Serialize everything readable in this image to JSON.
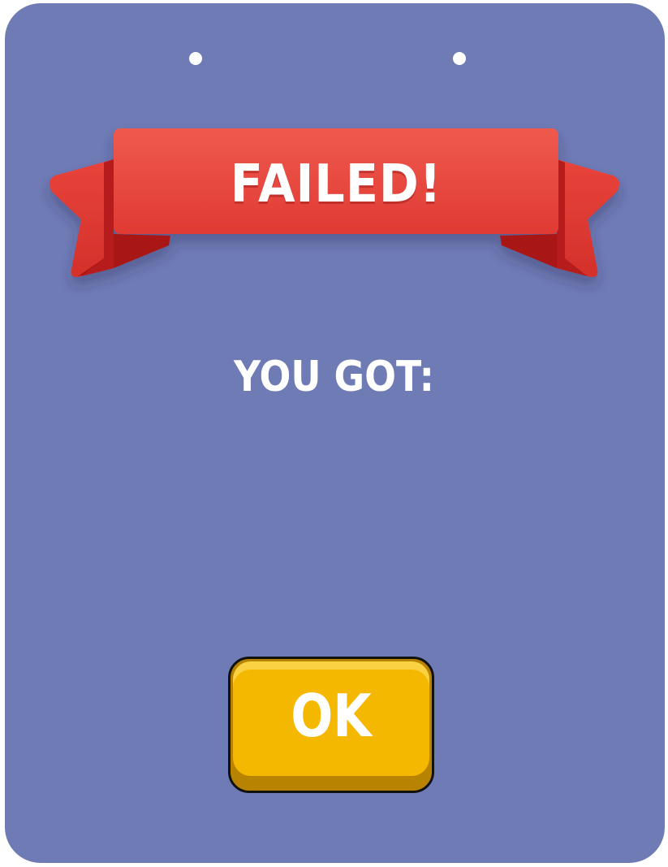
{
  "dialog": {
    "title": "FAILED!",
    "subtitle": "YOU GOT:",
    "ok_label": "OK"
  },
  "colors": {
    "panel": "#6f7bb5",
    "ribbon": "#e8473f",
    "ribbon_dark": "#b5181a",
    "button": "#f4b800",
    "button_shadow": "#b88300",
    "text": "#ffffff"
  },
  "icons": {
    "pins": "pin-dot-icon",
    "banner": "ribbon-banner"
  }
}
